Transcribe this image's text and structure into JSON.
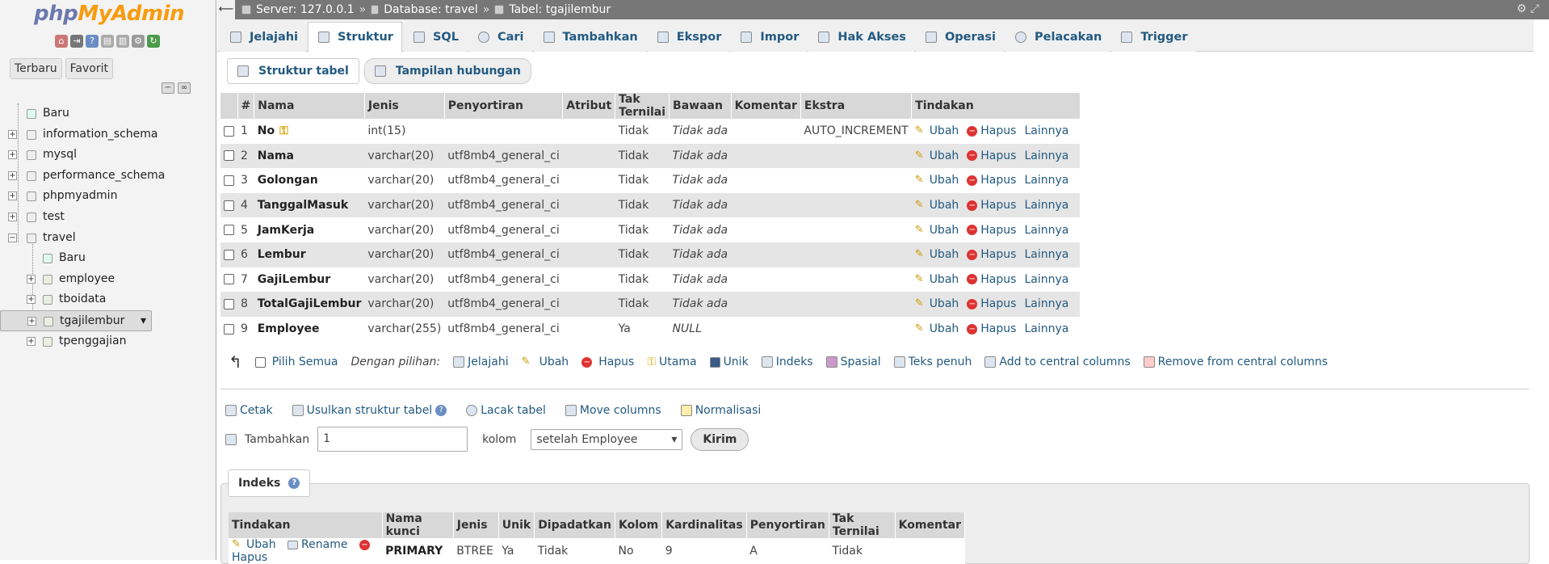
{
  "sidebar": {
    "logo_a": "php",
    "logo_b": "MyAdmin",
    "tabs": [
      "Terbaru",
      "Favorit"
    ],
    "tree": [
      {
        "label": "Baru",
        "kind": "new",
        "level": 0
      },
      {
        "label": "information_schema",
        "kind": "db",
        "level": 0
      },
      {
        "label": "mysql",
        "kind": "db",
        "level": 0
      },
      {
        "label": "performance_schema",
        "kind": "db",
        "level": 0
      },
      {
        "label": "phpmyadmin",
        "kind": "db",
        "level": 0
      },
      {
        "label": "test",
        "kind": "db",
        "level": 0
      },
      {
        "label": "travel",
        "kind": "db-open",
        "level": 0
      },
      {
        "label": "Baru",
        "kind": "new",
        "level": 1
      },
      {
        "label": "employee",
        "kind": "table",
        "level": 1
      },
      {
        "label": "tboidata",
        "kind": "table",
        "level": 1
      },
      {
        "label": "tgajilembur",
        "kind": "table",
        "level": 1,
        "selected": true
      },
      {
        "label": "tpenggajian",
        "kind": "table",
        "level": 1
      }
    ]
  },
  "breadcrumb": {
    "server": "Server: 127.0.0.1",
    "database": "Database: travel",
    "table": "Tabel: tgajilembur",
    "sep": "»"
  },
  "tabs": [
    "Jelajahi",
    "Struktur",
    "SQL",
    "Cari",
    "Tambahkan",
    "Ekspor",
    "Impor",
    "Hak Akses",
    "Operasi",
    "Pelacakan",
    "Trigger"
  ],
  "active_tab": "Struktur",
  "subtabs": [
    "Struktur tabel",
    "Tampilan hubungan"
  ],
  "structure": {
    "headers": [
      "#",
      "Nama",
      "Jenis",
      "Penyortiran",
      "Atribut",
      "Tak Ternilai",
      "Bawaan",
      "Komentar",
      "Ekstra",
      "Tindakan"
    ],
    "actions": {
      "edit": "Ubah",
      "drop": "Hapus",
      "more": "Lainnya"
    },
    "rows": [
      {
        "n": "1",
        "name": "No",
        "type": "int(15)",
        "coll": "",
        "attr": "",
        "null": "Tidak",
        "def": "Tidak ada",
        "comm": "",
        "extra": "AUTO_INCREMENT",
        "key": true
      },
      {
        "n": "2",
        "name": "Nama",
        "type": "varchar(20)",
        "coll": "utf8mb4_general_ci",
        "attr": "",
        "null": "Tidak",
        "def": "Tidak ada",
        "comm": "",
        "extra": ""
      },
      {
        "n": "3",
        "name": "Golongan",
        "type": "varchar(20)",
        "coll": "utf8mb4_general_ci",
        "attr": "",
        "null": "Tidak",
        "def": "Tidak ada",
        "comm": "",
        "extra": ""
      },
      {
        "n": "4",
        "name": "TanggalMasuk",
        "type": "varchar(20)",
        "coll": "utf8mb4_general_ci",
        "attr": "",
        "null": "Tidak",
        "def": "Tidak ada",
        "comm": "",
        "extra": ""
      },
      {
        "n": "5",
        "name": "JamKerja",
        "type": "varchar(20)",
        "coll": "utf8mb4_general_ci",
        "attr": "",
        "null": "Tidak",
        "def": "Tidak ada",
        "comm": "",
        "extra": ""
      },
      {
        "n": "6",
        "name": "Lembur",
        "type": "varchar(20)",
        "coll": "utf8mb4_general_ci",
        "attr": "",
        "null": "Tidak",
        "def": "Tidak ada",
        "comm": "",
        "extra": ""
      },
      {
        "n": "7",
        "name": "GajiLembur",
        "type": "varchar(20)",
        "coll": "utf8mb4_general_ci",
        "attr": "",
        "null": "Tidak",
        "def": "Tidak ada",
        "comm": "",
        "extra": ""
      },
      {
        "n": "8",
        "name": "TotalGajiLembur",
        "type": "varchar(20)",
        "coll": "utf8mb4_general_ci",
        "attr": "",
        "null": "Tidak",
        "def": "Tidak ada",
        "comm": "",
        "extra": ""
      },
      {
        "n": "9",
        "name": "Employee",
        "type": "varchar(255)",
        "coll": "utf8mb4_general_ci",
        "attr": "",
        "null": "Ya",
        "def": "NULL",
        "comm": "",
        "extra": ""
      }
    ]
  },
  "with_selected": {
    "check_all": "Pilih Semua",
    "label": "Dengan pilihan:",
    "actions": [
      "Jelajahi",
      "Ubah",
      "Hapus",
      "Utama",
      "Unik",
      "Indeks",
      "Spasial",
      "Teks penuh",
      "Add to central columns",
      "Remove from central columns"
    ]
  },
  "tools": [
    "Cetak",
    "Usulkan struktur tabel",
    "Lacak tabel",
    "Move columns",
    "Normalisasi"
  ],
  "add_columns": {
    "label": "Tambahkan",
    "value": "1",
    "unit": "kolom",
    "position": "setelah Employee",
    "submit": "Kirim"
  },
  "indexes": {
    "title": "Indeks",
    "headers": [
      "Tindakan",
      "Nama kunci",
      "Jenis",
      "Unik",
      "Dipadatkan",
      "Kolom",
      "Kardinalitas",
      "Penyortiran",
      "Tak Ternilai",
      "Komentar"
    ],
    "row": {
      "edit": "Ubah",
      "rename": "Rename",
      "drop": "Hapus",
      "keyname": "PRIMARY",
      "type": "BTREE",
      "unique": "Ya",
      "packed": "Tidak",
      "column": "No",
      "card": "9",
      "coll": "A",
      "null": "Tidak",
      "comment": ""
    }
  }
}
